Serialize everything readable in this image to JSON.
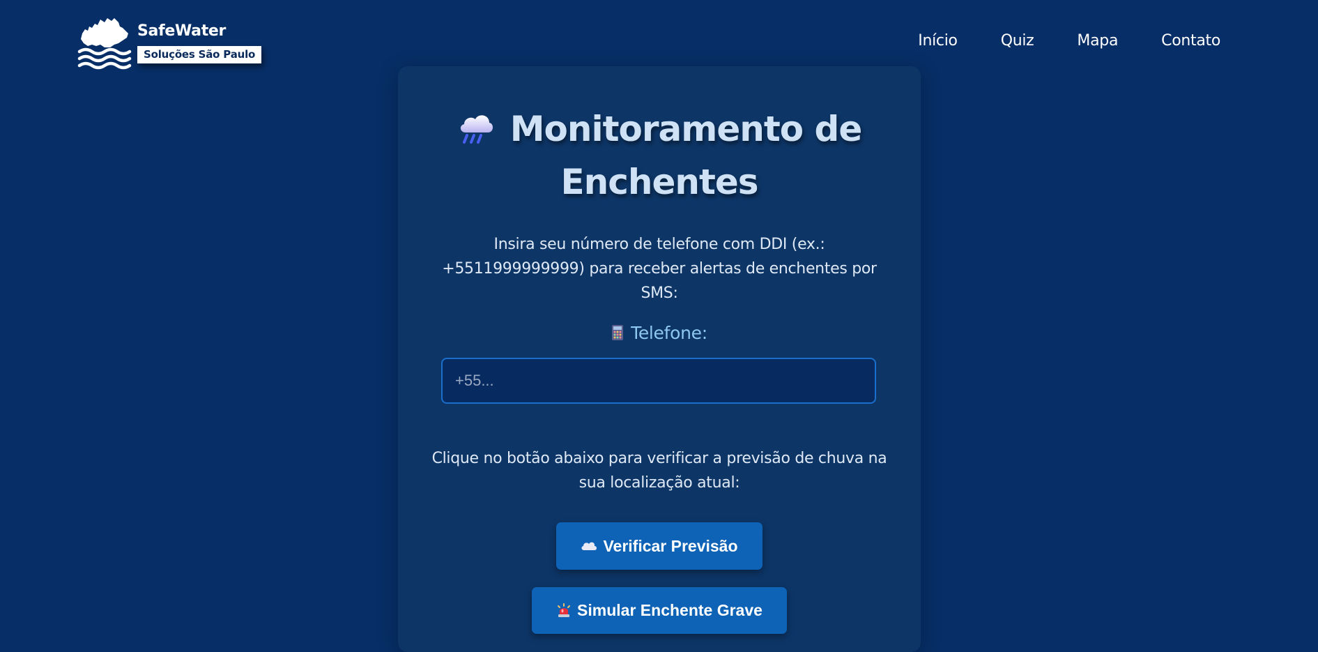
{
  "header": {
    "brand_name": "SafeWater",
    "brand_tagline": "Soluções São Paulo",
    "nav": [
      {
        "label": "Início"
      },
      {
        "label": "Quiz"
      },
      {
        "label": "Mapa"
      },
      {
        "label": "Contato"
      }
    ]
  },
  "main": {
    "title_line1": "Monitoramento de",
    "title_line2": "Enchentes",
    "title_icon": "rain-cloud-icon",
    "phone_instructions": "Insira seu número de telefone com DDI (ex.: +5511999999999) para receber alertas de enchentes por SMS:",
    "phone_label": "Telefone:",
    "phone_label_icon": "calculator-icon",
    "phone_input": {
      "value": "",
      "placeholder": "+55..."
    },
    "forecast_instructions": "Clique no botão abaixo para verificar a previsão de chuva na sua localização atual:",
    "forecast_button_label": "Verificar Previsão",
    "forecast_button_icon": "cloud-icon",
    "simulate_button_label": "Simular Enchente Grave",
    "simulate_button_icon": "siren-icon"
  },
  "colors": {
    "page_background": "#072e66",
    "card_background": "#0d3566",
    "title_text": "#cfe2f5",
    "label_accent": "#8ec8ee",
    "input_border": "#1a6fcc",
    "button_background": "#0e63b6"
  }
}
